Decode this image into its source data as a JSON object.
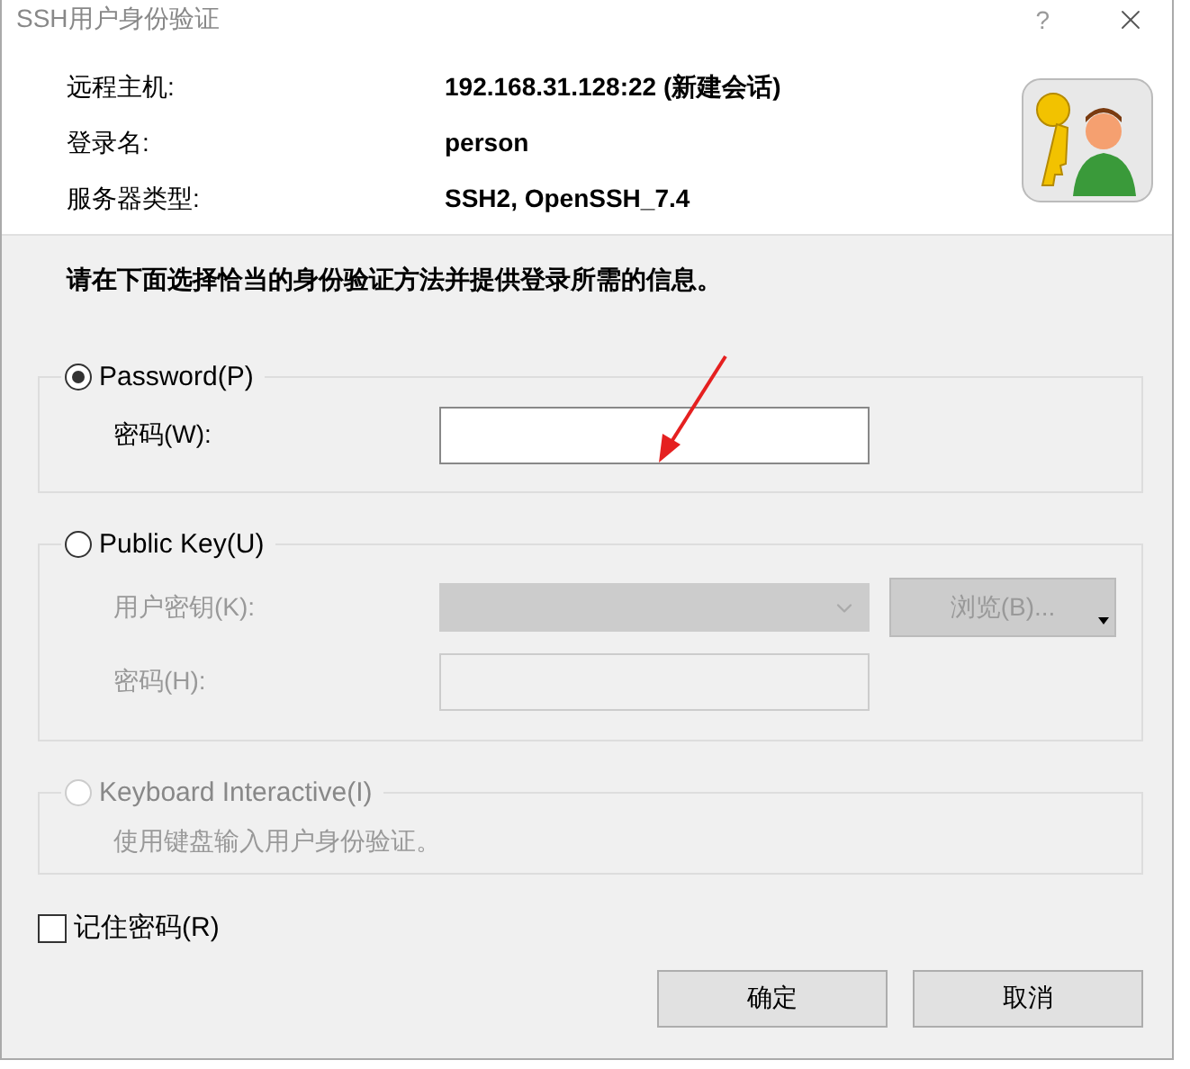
{
  "window": {
    "title": "SSH用户身份验证",
    "help": "?"
  },
  "info": [
    {
      "label": "远程主机:",
      "value": "192.168.31.128:22 (新建会话)"
    },
    {
      "label": "登录名:",
      "value": "person"
    },
    {
      "label": "服务器类型:",
      "value": "SSH2, OpenSSH_7.4"
    }
  ],
  "instruction": "请在下面选择恰当的身份验证方法并提供登录所需的信息。",
  "methods": [
    {
      "kind": "password",
      "label": "Password(P)",
      "selected": true,
      "disabled": false,
      "fields": [
        {
          "kind": "text",
          "label": "密码(W):",
          "disabled": false
        }
      ]
    },
    {
      "kind": "publickey",
      "label": "Public Key(U)",
      "selected": false,
      "disabled": false,
      "fields": [
        {
          "kind": "select",
          "label": "用户密钥(K):",
          "disabled": true
        },
        {
          "kind": "text",
          "label": "密码(H):",
          "disabled": true
        }
      ],
      "browse_button": "浏览(B)..."
    },
    {
      "kind": "keyboard",
      "label": "Keyboard Interactive(I)",
      "selected": false,
      "disabled": true,
      "description": "使用键盘输入用户身份验证。"
    }
  ],
  "remember": {
    "label": "记住密码(R)",
    "checked": false
  },
  "buttons": [
    "确定",
    "取消"
  ]
}
